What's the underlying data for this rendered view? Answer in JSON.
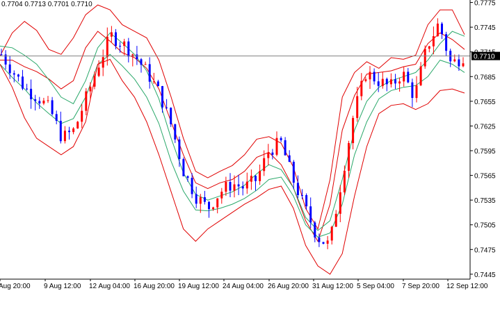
{
  "header": {
    "ohlc_text": "0.7704 0.7713 0.7701 0.7710"
  },
  "colors": {
    "up_candle": "#ff0000",
    "down_candle": "#0000ff",
    "bollinger_outer": "#e00000",
    "bollinger_inner_red": "#e00000",
    "bollinger_middle": "#2aa86a",
    "axis": "#000000",
    "current_price_line": "#808080",
    "price_tag_bg": "#000000",
    "price_tag_text": "#ffffff"
  },
  "chart_data": {
    "type": "candlestick",
    "title": "",
    "current_price": "0.7710",
    "y_ticks": [
      "0.7775",
      "0.7745",
      "0.7715",
      "0.7685",
      "0.7655",
      "0.7625",
      "0.7595",
      "0.7565",
      "0.7535",
      "0.7505",
      "0.7475",
      "0.7445"
    ],
    "x_ticks": [
      "Aug 20:00",
      "9 Aug 12:00",
      "12 Aug 04:00",
      "16 Aug 20:00",
      "19 Aug 12:00",
      "24 Aug 04:00",
      "26 Aug 20:00",
      "31 Aug 12:00",
      "5 Sep 04:00",
      "7 Sep 20:00",
      "12 Sep 12:00"
    ],
    "ylim": [
      0.7439,
      0.7778
    ],
    "series": [
      {
        "indicator": "bollinger_upper",
        "values": [
          0.771,
          0.7738,
          0.7752,
          0.7741,
          0.7718,
          0.7712,
          0.7732,
          0.776,
          0.7772,
          0.7766,
          0.7748,
          0.774,
          0.7732,
          0.7705,
          0.766,
          0.761,
          0.757,
          0.7562,
          0.757,
          0.7577,
          0.759,
          0.7609,
          0.7612,
          0.7604,
          0.7575,
          0.7525,
          0.75,
          0.756,
          0.766,
          0.769,
          0.7703,
          0.7695,
          0.7708,
          0.7706,
          0.7711,
          0.7748,
          0.7766,
          0.7766,
          0.7736
        ]
      },
      {
        "indicator": "bollinger_upper_inner",
        "values": [
          0.7705,
          0.7705,
          0.7697,
          0.7691,
          0.7682,
          0.767,
          0.768,
          0.772,
          0.774,
          0.7728,
          0.7714,
          0.7708,
          0.7695,
          0.767,
          0.763,
          0.759,
          0.7556,
          0.7549,
          0.7556,
          0.756,
          0.757,
          0.7587,
          0.7593,
          0.7578,
          0.755,
          0.751,
          0.7485,
          0.753,
          0.762,
          0.7662,
          0.7688,
          0.769,
          0.7692,
          0.7697,
          0.77,
          0.7725,
          0.7738,
          0.773,
          0.7718
        ]
      },
      {
        "indicator": "bollinger_middle",
        "values": [
          0.7722,
          0.772,
          0.7711,
          0.77,
          0.7681,
          0.766,
          0.7652,
          0.768,
          0.772,
          0.7738,
          0.7726,
          0.7712,
          0.7692,
          0.7658,
          0.761,
          0.7568,
          0.7542,
          0.7535,
          0.754,
          0.7545,
          0.7553,
          0.7567,
          0.7578,
          0.7572,
          0.755,
          0.7514,
          0.7498,
          0.751,
          0.756,
          0.762,
          0.7655,
          0.7672,
          0.768,
          0.7685,
          0.769,
          0.7705,
          0.7725,
          0.774,
          0.7734
        ]
      },
      {
        "indicator": "bollinger_lower_inner",
        "values": [
          0.77,
          0.7684,
          0.767,
          0.7653,
          0.764,
          0.7628,
          0.7634,
          0.766,
          0.77,
          0.7712,
          0.7698,
          0.7682,
          0.766,
          0.7628,
          0.7582,
          0.7546,
          0.7523,
          0.7522,
          0.7525,
          0.753,
          0.7537,
          0.7547,
          0.756,
          0.7563,
          0.754,
          0.7505,
          0.749,
          0.7495,
          0.753,
          0.759,
          0.763,
          0.7658,
          0.7668,
          0.7672,
          0.7674,
          0.7685,
          0.7705,
          0.77,
          0.769
        ]
      },
      {
        "indicator": "bollinger_lower",
        "values": [
          0.77,
          0.7672,
          0.7635,
          0.761,
          0.76,
          0.759,
          0.76,
          0.763,
          0.77,
          0.7706,
          0.768,
          0.766,
          0.763,
          0.759,
          0.7545,
          0.75,
          0.7485,
          0.75,
          0.751,
          0.752,
          0.753,
          0.7538,
          0.7548,
          0.7552,
          0.7525,
          0.748,
          0.7455,
          0.7445,
          0.747,
          0.754,
          0.76,
          0.764,
          0.765,
          0.7652,
          0.7645,
          0.7652,
          0.7668,
          0.767,
          0.7665
        ]
      },
      {
        "indicator": "price_close_path",
        "values": [
          0.7712,
          0.769,
          0.767,
          0.766,
          0.7645,
          0.761,
          0.762,
          0.766,
          0.77,
          0.7735,
          0.7725,
          0.771,
          0.769,
          0.7665,
          0.7625,
          0.757,
          0.754,
          0.7525,
          0.7545,
          0.7555,
          0.755,
          0.756,
          0.7595,
          0.7605,
          0.756,
          0.7525,
          0.749,
          0.748,
          0.756,
          0.764,
          0.769,
          0.768,
          0.7672,
          0.769,
          0.766,
          0.772,
          0.775,
          0.77,
          0.771
        ]
      }
    ]
  }
}
